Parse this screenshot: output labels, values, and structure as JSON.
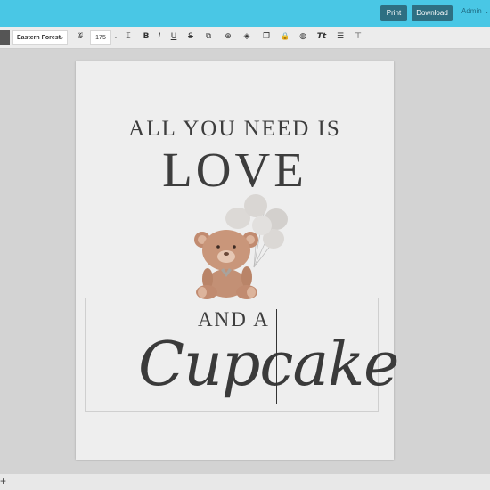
{
  "header": {
    "print_label": "Print",
    "download_label": "Download",
    "admin_label": "Admin",
    "admin_chevron": "⌄"
  },
  "toolbar": {
    "font_name": "Eastern Forest",
    "font_size": "175",
    "chevron": "⌄",
    "icons": {
      "glyph": "𝒢",
      "line_height": "⌶",
      "bold": "B",
      "italic": "I",
      "underline": "U",
      "strike": "S",
      "link": "⧉",
      "duplicate": "⊕",
      "layers": "◈",
      "copy": "❐",
      "lock": "🔒",
      "color": "◍",
      "text_transform": "Tt",
      "list": "☰",
      "align": "⊤"
    }
  },
  "canvas": {
    "line1": "ALL YOU NEED IS",
    "line2": "LOVE",
    "line3": "AND A",
    "line4": "Cupcake"
  },
  "bottom": {
    "add_label": "+"
  },
  "colors": {
    "topbar": "#49c7e5",
    "button": "#2e6f82",
    "text": "#3d3d3d",
    "bear": "#c9967a"
  }
}
